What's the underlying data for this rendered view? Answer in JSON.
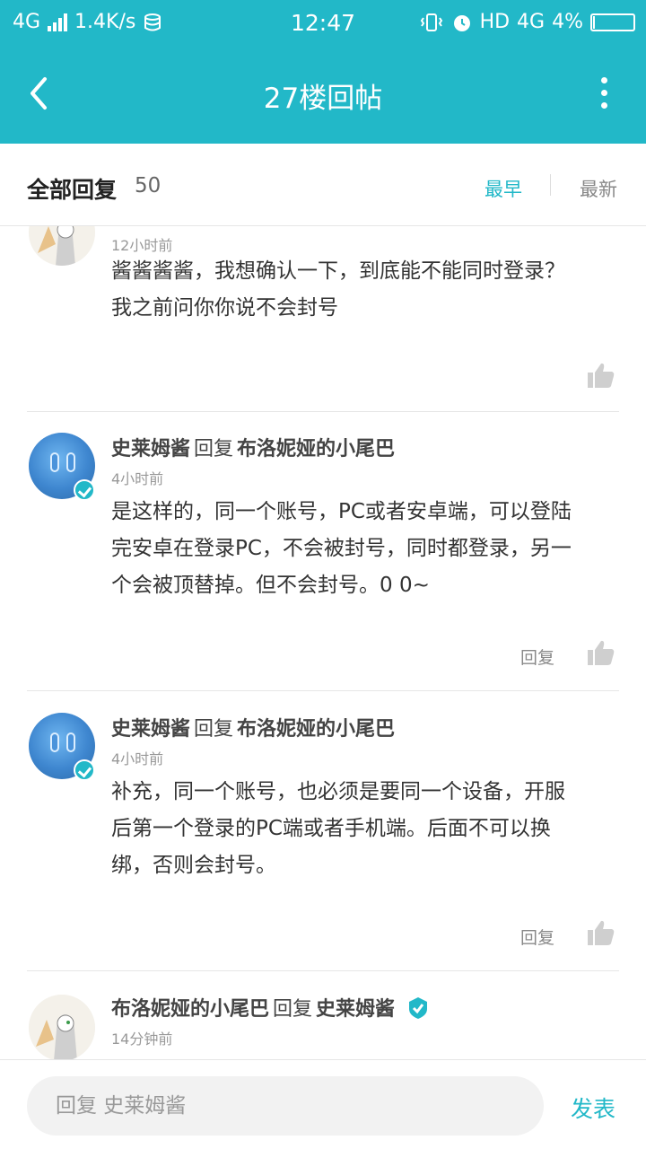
{
  "status_bar": {
    "network": "4G",
    "speed": "1.4K/s",
    "time": "12:47",
    "hd": "HD",
    "network_right": "4G",
    "battery": "4%",
    "battery_level": 0.04
  },
  "header": {
    "title": "27楼回帖"
  },
  "sort_bar": {
    "all_label": "全部回复",
    "count": "50",
    "earliest": "最早",
    "latest": "最新"
  },
  "posts": [
    {
      "time": "12小时前",
      "lines": [
        "酱酱酱酱，我想确认一下，到底能不能同时登录？",
        "我之前问你你说不会封号"
      ]
    },
    {
      "author": "史莱姆酱",
      "reply_word": "回复",
      "reply_to": "布洛妮娅的小尾巴",
      "time": "4小时前",
      "lines": [
        "是这样的，同一个账号，PC或者安卓端，可以登陆",
        "完安卓在登录PC，不会被封号，同时都登录，另一",
        "个会被顶替掉。但不会封号。0 0~"
      ],
      "reply_btn": "回复"
    },
    {
      "author": "史莱姆酱",
      "reply_word": "回复",
      "reply_to": "布洛妮娅的小尾巴",
      "time": "4小时前",
      "lines": [
        "补充，同一个账号，也必须是要同一个设备，开服",
        "后第一个登录的PC端或者手机端。后面不可以换",
        "绑，否则会封号。"
      ],
      "reply_btn": "回复"
    },
    {
      "author": "布洛妮娅的小尾巴",
      "reply_word": "回复",
      "reply_to": "史莱姆酱",
      "time": "14分钟前"
    }
  ],
  "footer": {
    "placeholder": "回复 史莱姆酱",
    "send": "发表"
  },
  "colors": {
    "accent": "#22b8c8",
    "text": "#333333",
    "muted": "#999999"
  }
}
